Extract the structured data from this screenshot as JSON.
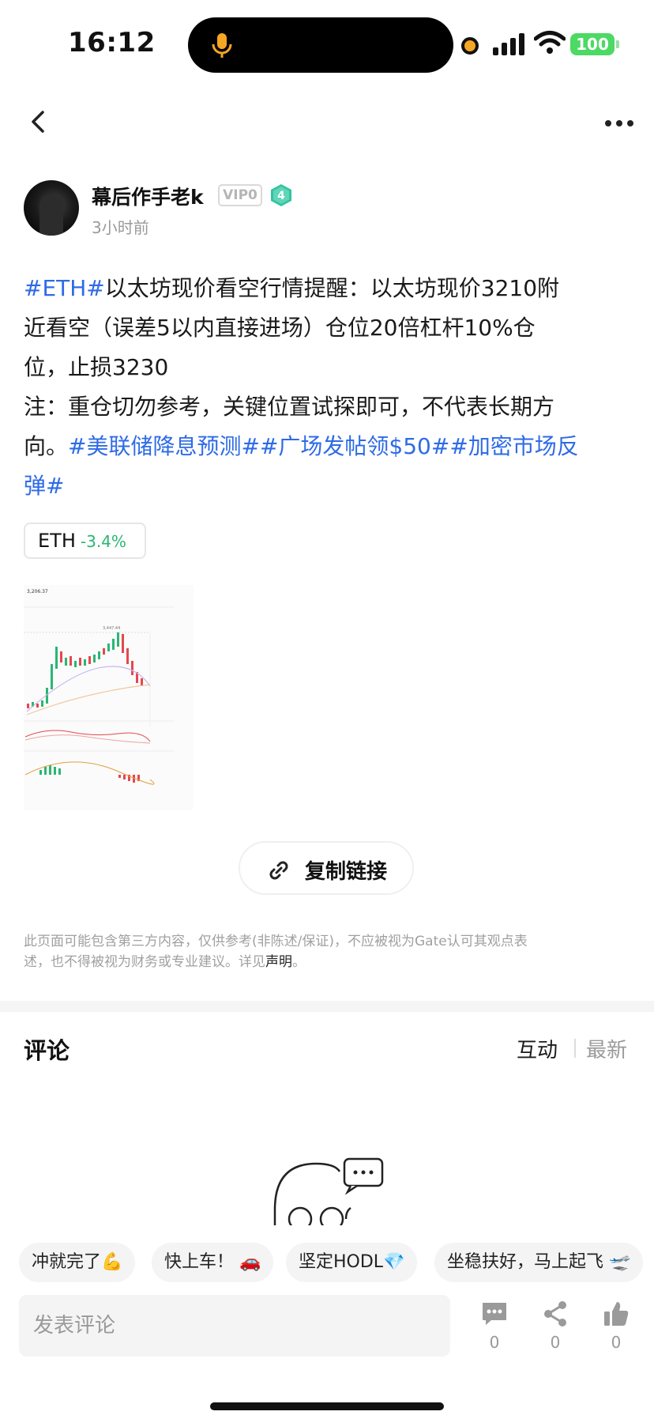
{
  "status_bar": {
    "time": "16:12",
    "battery": "100"
  },
  "author": {
    "name": "幕后作手老k",
    "vip": "VIP0",
    "level": "4",
    "posted": "3小时前"
  },
  "post": {
    "line1": {
      "tag": "#ETH#",
      "text": "以太坊现价看空行情提醒：以太坊现价3210附"
    },
    "line2": "近看空（误差5以内直接进场）仓位20倍杠杆10%仓",
    "line3": "位，止损3230",
    "line4": "注：重仓切勿参考，关键位置试探即可，不代表长期方",
    "line5": {
      "text": "向。",
      "tag1": "#美联储降息预测#",
      "tag2": "#广场发帖领$50#",
      "tag3_part": "#加密市场反"
    },
    "line6": {
      "tag3_end": "弹#"
    }
  },
  "coin": {
    "symbol": "ETH",
    "change": "-3.4%"
  },
  "chart_labels": {
    "price": "3,206.37",
    "high": "3,447.44"
  },
  "copy_link": {
    "label": "复制链接"
  },
  "disclaimer": {
    "text1": "此页面可能包含第三方内容，仅供参考(非陈述/保证)，不应被视为Gate认可其观点表",
    "text2": "述，也不得被视为财务或专业建议。详见",
    "link": "声明",
    "end": "。"
  },
  "comments": {
    "title": "评论",
    "sort_hot": "互动",
    "sort_new": "最新"
  },
  "quick_replies": [
    "冲就完了💪",
    "快上车！ 🚗",
    "坚定HODL💎",
    "坐稳扶好，马上起飞 🛫"
  ],
  "composer": {
    "placeholder": "发表评论"
  },
  "actions": {
    "comment_count": "0",
    "share_count": "0",
    "like_count": "0"
  },
  "colors": {
    "tag": "#2e6be6",
    "up": "#2bb673",
    "down": "#e5484d",
    "battery": "#4cd964",
    "level_badge": "#35c3a0"
  },
  "icons": [
    "mic-icon",
    "signal-icon",
    "wifi-icon",
    "back-icon",
    "more-icon",
    "level-icon",
    "link-icon",
    "comment-icon",
    "share-icon",
    "like-icon"
  ]
}
